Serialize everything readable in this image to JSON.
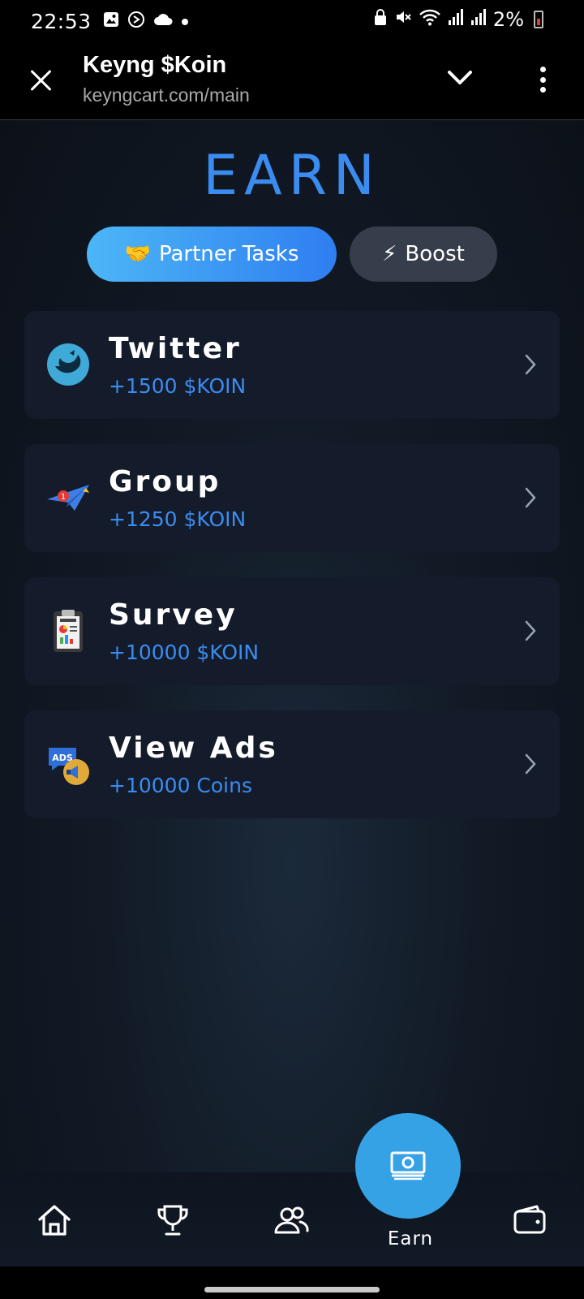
{
  "status_bar": {
    "time": "22:53",
    "battery_text": "2%",
    "left_icons": [
      "image-icon",
      "sync-icon",
      "cloud-icon",
      "dot-icon"
    ],
    "right_icons": [
      "lock-icon",
      "mute-icon",
      "wifi-icon",
      "signal-icon",
      "signal-icon",
      "battery-icon"
    ]
  },
  "browser": {
    "title": "Keyng $Koin",
    "url": "keyngcart.com/main"
  },
  "page": {
    "title": "EARN",
    "tabs": [
      {
        "label": "Partner Tasks",
        "icon": "🤝",
        "active": true
      },
      {
        "label": "Boost",
        "icon": "⚡",
        "active": false
      }
    ],
    "tasks": [
      {
        "title": "Twitter",
        "reward": "+1500 $KOIN",
        "icon": "twitter-bird-icon"
      },
      {
        "title": "Group",
        "reward": "+1250 $KOIN",
        "icon": "paper-plane-icon"
      },
      {
        "title": "Survey",
        "reward": "+10000 $KOIN",
        "icon": "clipboard-survey-icon"
      },
      {
        "title": "View Ads",
        "reward": "+10000 Coins",
        "icon": "ads-megaphone-icon"
      }
    ]
  },
  "bottom_nav": {
    "items": [
      "home-icon",
      "trophy-icon",
      "friends-icon",
      "money-icon",
      "wallet-icon"
    ],
    "earn_label": "Earn"
  },
  "colors": {
    "accent": "#3b8cf0",
    "tab_active_start": "#4cb6f6",
    "tab_active_end": "#2f7ef0",
    "card_bg": "#141b2a",
    "fab": "#36a2e6"
  }
}
